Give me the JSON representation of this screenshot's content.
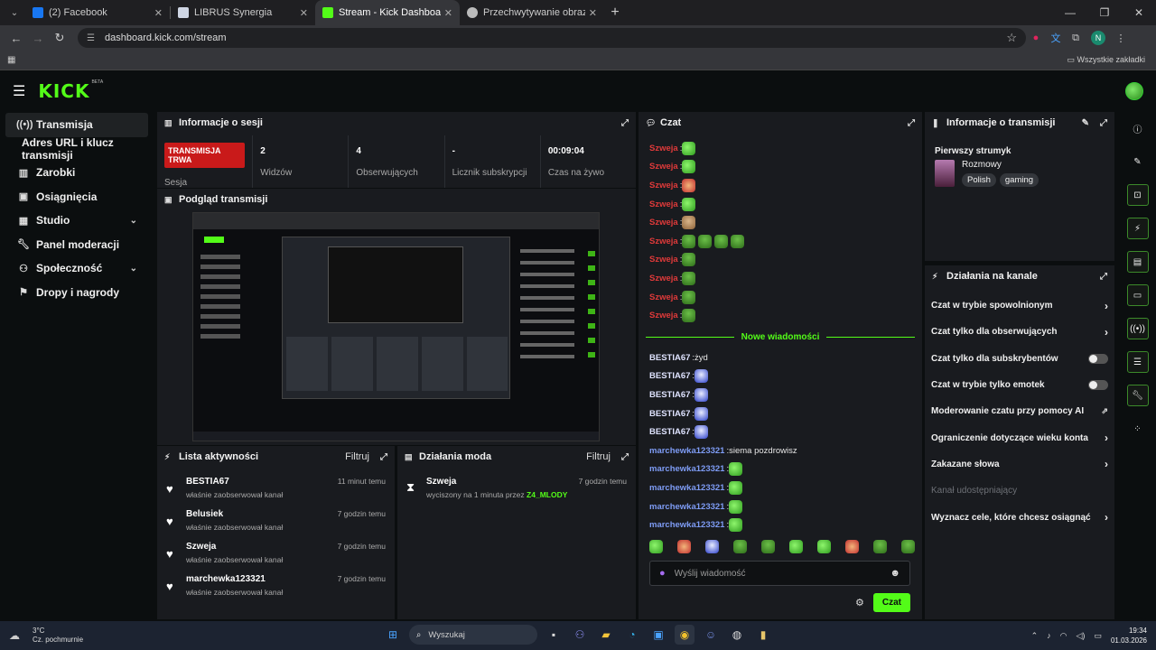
{
  "browser": {
    "tabs": [
      {
        "label": "(2) Facebook",
        "color": "#1877f2"
      },
      {
        "label": "LIBRUS Synergia",
        "color": "#cfd6e4"
      },
      {
        "label": "Stream - Kick Dashboard",
        "color": "#53fc18"
      },
      {
        "label": "Przechwytywanie obrazu w OBS",
        "color": "#bbbbbb"
      }
    ],
    "url": "dashboard.kick.com/stream",
    "all_bookmarks": "Wszystkie zakładki",
    "profile_initial": "N"
  },
  "header": {
    "logo": "KICK",
    "beta": "BETA"
  },
  "sidebar": {
    "items": [
      {
        "label": "Transmisja",
        "icon": "broadcast-icon"
      },
      {
        "label": "Adres URL i klucz transmisji"
      },
      {
        "label": "Zarobki",
        "icon": "chart-icon"
      },
      {
        "label": "Osiągnięcia",
        "icon": "trophy-icon"
      },
      {
        "label": "Studio",
        "icon": "studio-icon"
      },
      {
        "label": "Panel moderacji",
        "icon": "wrench-icon"
      },
      {
        "label": "Społeczność",
        "icon": "people-icon"
      },
      {
        "label": "Dropy i nagrody",
        "icon": "gift-icon"
      }
    ]
  },
  "session": {
    "title": "Informacje o sesji",
    "badge": "TRANSMISJA TRWA",
    "badge_label": "Sesja",
    "stats": [
      {
        "value": "2",
        "label": "Widzów"
      },
      {
        "value": "4",
        "label": "Obserwujących"
      },
      {
        "value": "-",
        "label": "Licznik subskrypcji"
      },
      {
        "value": "00:09:04",
        "label": "Czas na żywo"
      }
    ]
  },
  "preview": {
    "title": "Podgląd transmisji"
  },
  "activity": {
    "title": "Lista aktywności",
    "filter": "Filtruj",
    "items": [
      {
        "name": "BESTIA67",
        "desc": "właśnie zaobserwował kanał",
        "time": "11 minut temu"
      },
      {
        "name": "Belusiek",
        "desc": "właśnie zaobserwował kanał",
        "time": "7 godzin temu"
      },
      {
        "name": "Szweja",
        "desc": "właśnie zaobserwował kanał",
        "time": "7 godzin temu"
      },
      {
        "name": "marchewka123321",
        "desc": "właśnie zaobserwował kanał",
        "time": "7 godzin temu"
      }
    ]
  },
  "mod": {
    "title": "Działania moda",
    "filter": "Filtruj",
    "items": [
      {
        "name": "Szweja",
        "action": "wyciszony na 1 minuta przez",
        "by": "Z4_MLODY",
        "time": "7 godzin temu"
      }
    ]
  },
  "chat": {
    "title": "Czat",
    "new_messages": "Nowe wiadomości",
    "messages_before": [
      {
        "user": "Szweja",
        "emotes": [
          "e-green"
        ]
      },
      {
        "user": "Szweja",
        "emotes": [
          "e-green"
        ]
      },
      {
        "user": "Szweja",
        "emotes": [
          "e-red"
        ]
      },
      {
        "user": "Szweja",
        "emotes": [
          "e-green"
        ]
      },
      {
        "user": "Szweja",
        "emotes": [
          "e-tan"
        ]
      },
      {
        "user": "Szweja",
        "emotes": [
          "e-pepe",
          "e-pepe",
          "e-pepe",
          "e-pepe"
        ]
      },
      {
        "user": "Szweja",
        "emotes": [
          "e-pepe"
        ]
      },
      {
        "user": "Szweja",
        "emotes": [
          "e-pepe"
        ]
      },
      {
        "user": "Szweja",
        "emotes": [
          "e-pepe"
        ]
      },
      {
        "user": "Szweja",
        "emotes": [
          "e-pepe"
        ]
      }
    ],
    "messages_after": [
      {
        "user": "BESTIA67",
        "text": "żyd",
        "color": "w",
        "emotes": []
      },
      {
        "user": "BESTIA67",
        "text": "",
        "color": "w",
        "emotes": [
          "e-blue"
        ]
      },
      {
        "user": "BESTIA67",
        "text": "",
        "color": "w",
        "emotes": [
          "e-blue"
        ]
      },
      {
        "user": "BESTIA67",
        "text": "",
        "color": "w",
        "emotes": [
          "e-blue"
        ]
      },
      {
        "user": "BESTIA67",
        "text": "",
        "color": "w",
        "emotes": [
          "e-blue"
        ]
      },
      {
        "user": "marchewka123321",
        "text": "siema pozdrowisz",
        "color": "blue",
        "emotes": []
      },
      {
        "user": "marchewka123321",
        "text": "",
        "color": "blue",
        "emotes": [
          "e-green"
        ]
      },
      {
        "user": "marchewka123321",
        "text": "",
        "color": "blue",
        "emotes": [
          "e-green"
        ]
      },
      {
        "user": "marchewka123321",
        "text": "",
        "color": "blue",
        "emotes": [
          "e-green"
        ]
      },
      {
        "user": "marchewka123321",
        "text": "",
        "color": "blue",
        "emotes": [
          "e-green"
        ]
      }
    ],
    "emote_bar": [
      "e-green",
      "e-red",
      "e-blue",
      "e-pepe",
      "e-pepe",
      "e-green",
      "e-green",
      "e-red",
      "e-pepe",
      "e-pepe"
    ],
    "placeholder": "Wyślij wiadomość",
    "send": "Czat"
  },
  "stream_info": {
    "title": "Informacje o transmisji",
    "stream_title": "Pierwszy strumyk",
    "category": "Rozmowy",
    "tags": [
      "Polish",
      "gaming"
    ]
  },
  "channel": {
    "title": "Działania na kanale",
    "items": [
      {
        "label": "Czat w trybie spowolnionym",
        "control": "arrow"
      },
      {
        "label": "Czat tylko dla obserwujących",
        "control": "arrow"
      },
      {
        "label": "Czat tylko dla subskrybentów",
        "control": "toggle"
      },
      {
        "label": "Czat w trybie tylko emotek",
        "control": "toggle"
      },
      {
        "label": "Moderowanie czatu przy pomocy AI",
        "control": "external"
      },
      {
        "label": "Ograniczenie dotyczące wieku konta",
        "control": "arrow"
      },
      {
        "label": "Zakazane słowa",
        "control": "arrow"
      },
      {
        "label": "Kanał udostępniający",
        "control": "none"
      },
      {
        "label": "Wyznacz cele, które chcesz osiągnąć",
        "control": "arrow"
      }
    ]
  },
  "taskbar": {
    "temp": "3°C",
    "weather": "Cz. pochmurnie",
    "search": "Wyszukaj",
    "time": "19:34",
    "date": "01.03.2026"
  },
  "accent": "#53fc18",
  "live_color": "#c91a1a"
}
